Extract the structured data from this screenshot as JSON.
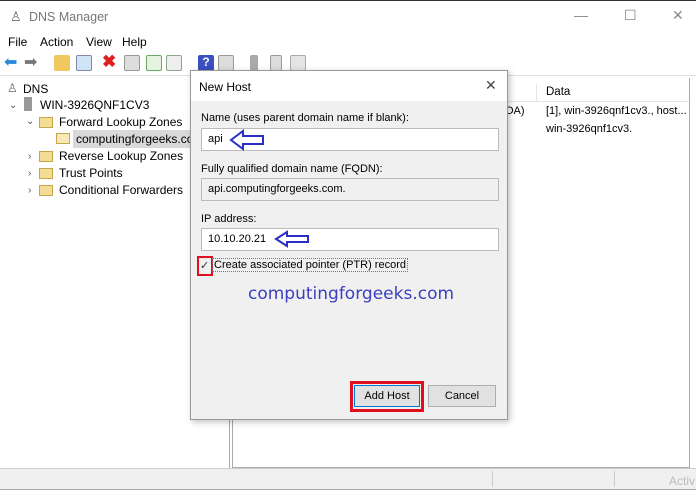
{
  "window": {
    "title": "DNS Manager",
    "minimize": "—",
    "maximize": "☐",
    "close": "✕"
  },
  "menu": [
    "File",
    "Action",
    "View",
    "Help"
  ],
  "tree": {
    "root": "DNS",
    "server": "WIN-3926QNF1CV3",
    "forward": "Forward Lookup Zones",
    "zone": "computingforgeeks.com",
    "reverse": "Reverse Lookup Zones",
    "trust": "Trust Points",
    "conditional": "Conditional Forwarders"
  },
  "list": {
    "header_data": "Data",
    "rows": [
      {
        "type_fragment": "OA)",
        "data": "[1], win-3926qnf1cv3., host..."
      },
      {
        "type_fragment": "",
        "data": "win-3926qnf1cv3."
      }
    ]
  },
  "dialog": {
    "title": "New Host",
    "close": "✕",
    "name_label": "Name (uses parent domain name if blank):",
    "name_value": "api",
    "fqdn_label": "Fully qualified domain name (FQDN):",
    "fqdn_value": "api.computingforgeeks.com.",
    "ip_label": "IP address:",
    "ip_value": "10.10.20.21",
    "ptr_label": "Create associated pointer (PTR) record",
    "ptr_checked": true,
    "watermark": "computingforgeeks.com",
    "add_button": "Add Host",
    "cancel_button": "Cancel"
  },
  "status": {
    "activation_fragment": "Activ"
  },
  "colors": {
    "annotation_arrow": "#2b2fc4",
    "highlight_box": "#e0101e",
    "watermark": "#3a3fc0"
  }
}
